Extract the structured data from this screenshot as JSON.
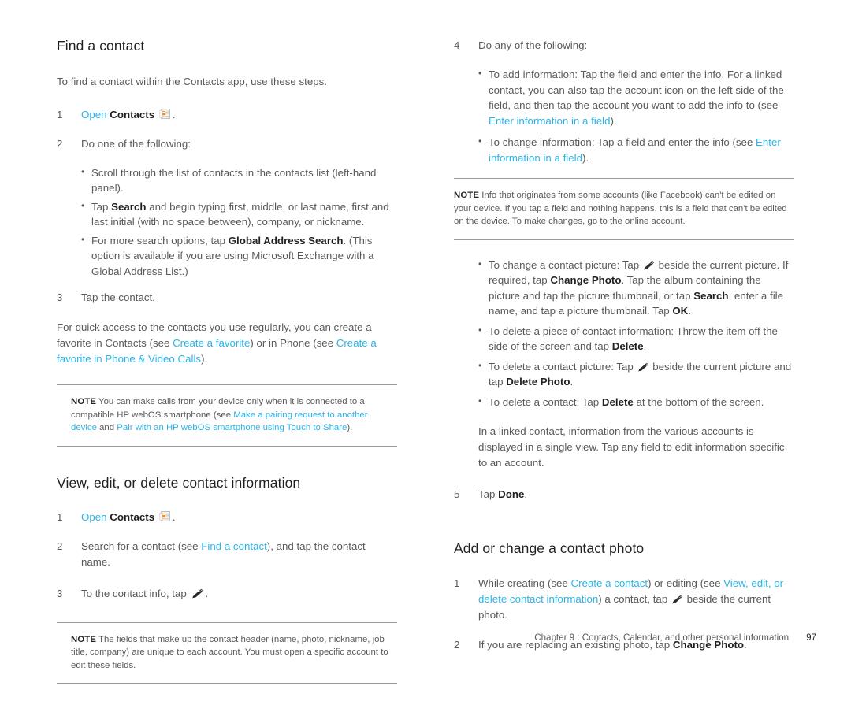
{
  "document": {
    "page_number": "97",
    "footer_text": "Chapter 9 :  Contacts, Calendar, and other personal information"
  },
  "icons": {
    "contacts": "contacts-app-icon",
    "pencil": "pencil-edit-icon"
  },
  "colors": {
    "link": "#2cb4e8",
    "body_text": "#58595b",
    "heading": "#231f20",
    "rule": "#9a9a9a",
    "icon_accent": "#f08a1e"
  },
  "left_column": {
    "heading_find": "Find a contact",
    "intro": "To find a contact within the Contacts app, use these steps.",
    "step1_num": "1",
    "step1_open": "Open",
    "step1_contacts": "Contacts",
    "step1_period": ".",
    "step2_num": "2",
    "step2_text": "Do one of the following:",
    "bullet1": "Scroll through the list of contacts in the contacts list (left-hand panel).",
    "bullet2_pre": "Tap ",
    "bullet2_bold": "Search",
    "bullet2_post": " and begin typing first, middle, or last name, first and last initial (with no space between), company, or nickname.",
    "bullet3_pre": "For more search options, tap ",
    "bullet3_bold": "Global Address Search",
    "bullet3_post": ". (This option is available if you are using Microsoft Exchange with a Global Address List.)",
    "step3_num": "3",
    "step3_text": "Tap the contact.",
    "favorite_para_1": "For quick access to the contacts you use regularly, you can create a favorite in Contacts (see ",
    "favorite_link_1": "Create a favorite",
    "favorite_para_2": ") or in Phone (see ",
    "favorite_link_2": "Create a favorite in Phone & Video Calls",
    "favorite_para_3": ").",
    "note1_label": "NOTE",
    "note1_text_1": "You can make calls from your device only when it is connected to a compatible HP webOS smartphone (see ",
    "note1_link_1": "Make a pairing request to another device",
    "note1_text_2": " and ",
    "note1_link_2": "Pair with an HP webOS smartphone using Touch to Share",
    "note1_text_3": ").",
    "heading_view": "View, edit, or delete contact information",
    "v_step1_num": "1",
    "v_step1_open": "Open",
    "v_step1_contacts": "Contacts",
    "v_step1_period": ".",
    "v_step2_num": "2",
    "v_step2_pre": "Search for a contact (see ",
    "v_step2_link": "Find a contact",
    "v_step2_post": "), and tap the contact name.",
    "v_step3_num": "3",
    "v_step3_pre": "To the contact info, tap ",
    "v_step3_post": ".",
    "note2_label": "NOTE",
    "note2_text": "The fields that make up the contact header (name, photo, nickname, job title, company) are unique to each account. You must open a specific account to edit these fields."
  },
  "right_column": {
    "step4_num": "4",
    "step4_text": "Do any of the following:",
    "r_bullet1_pre": "To add information: Tap the field and enter the info.  For a linked contact, you can also tap the account icon on the left side of the field, and then tap the account you want to add the info to (see ",
    "r_bullet1_link": "Enter information in a field",
    "r_bullet1_post": ").",
    "r_bullet2_pre": "To change information: Tap a field and enter the info (see ",
    "r_bullet2_link": "Enter information in a field",
    "r_bullet2_post": ").",
    "note3_label": "NOTE",
    "note3_text": "Info that originates from some accounts (like Facebook) can't be edited on your device. If you tap a field and nothing happens, this is a field that can't be edited on the device.  To make changes, go to the online account.",
    "r_bullet3_pre": "To change a contact picture: Tap ",
    "r_bullet3_mid1": " beside the current picture. If required, tap ",
    "r_bullet3_b1": "Change Photo",
    "r_bullet3_mid2": ". Tap the album containing the picture and tap the picture thumbnail, or tap ",
    "r_bullet3_b2": "Search",
    "r_bullet3_mid3": ", enter a file name, and tap a picture thumbnail. Tap ",
    "r_bullet3_b3": "OK",
    "r_bullet3_post": ".",
    "r_bullet4_pre": "To delete a piece of contact information: Throw the item off the side of the screen and tap ",
    "r_bullet4_b1": "Delete",
    "r_bullet4_post": ".",
    "r_bullet5_pre": "To delete a contact picture: Tap ",
    "r_bullet5_mid": " beside the current picture and tap ",
    "r_bullet5_b1": "Delete Photo",
    "r_bullet5_post": ".",
    "r_bullet6_pre": "To delete a contact: Tap ",
    "r_bullet6_b1": "Delete",
    "r_bullet6_post": " at the bottom of the screen.",
    "linked_para": "In a linked contact, information from the various accounts is displayed in a single view. Tap any field to edit information specific to an account.",
    "step5_num": "5",
    "step5_pre": "Tap ",
    "step5_bold": "Done",
    "step5_post": ".",
    "heading_photo": "Add or change a contact photo",
    "p_step1_num": "1",
    "p_step1_pre": "While creating (see ",
    "p_step1_link1": "Create a contact",
    "p_step1_mid": ") or editing (see ",
    "p_step1_link2": "View, edit, or delete contact information",
    "p_step1_mid2": ") a contact, tap ",
    "p_step1_post": " beside the current photo.",
    "p_step2_num": "2",
    "p_step2_pre": "If you are replacing an existing photo, tap ",
    "p_step2_bold": "Change Photo",
    "p_step2_post": "."
  }
}
